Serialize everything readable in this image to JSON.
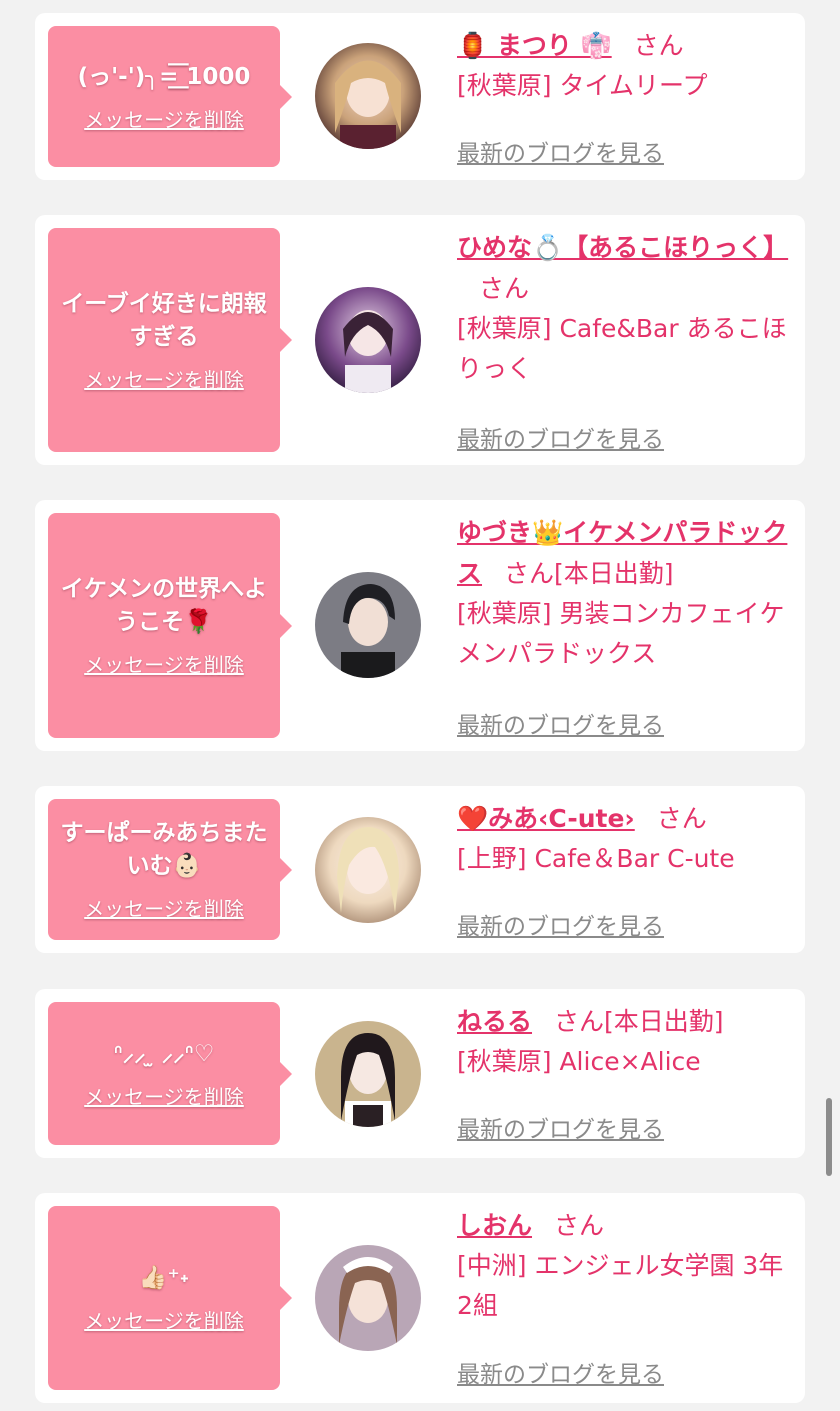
{
  "delete_label": "メッセージを削除",
  "blog_label": "最新のブログを見る",
  "san_label": "さん",
  "colors": {
    "background": "#f2f2f2",
    "card": "#ffffff",
    "bubble": "#fb8ea3",
    "accent": "#e4336a",
    "muted": "#8a8a8a"
  },
  "messages": [
    {
      "message": "(っ'-')╮=͟͟͞͞ 1000",
      "name": "🏮 まつり 👘",
      "badge": "",
      "shop": "[秋葉原] タイムリープ",
      "avatar_icon": "avatar-photo"
    },
    {
      "message": "イーブイ好きに朗報すぎる",
      "name": "ひめな💍【あるこほりっく】",
      "badge": "",
      "shop": "[秋葉原] Cafe&Bar あるこほりっく",
      "avatar_icon": "avatar-photo"
    },
    {
      "message": "イケメンの世界へようこそ🌹",
      "name": "ゆづき👑イケメンパラドックス",
      "badge": "[本日出勤]",
      "shop": "[秋葉原] 男装コンカフェイケメンパラドックス",
      "avatar_icon": "avatar-photo"
    },
    {
      "message": "すーぱーみあちまたいむ👶🏻",
      "name": "❤️みあ‹C-ute›",
      "badge": "",
      "shop": "[上野] Cafe＆Bar C-ute",
      "avatar_icon": "avatar-photo"
    },
    {
      "message": "ᐢ⸝⸝ ̫ ⸝⸝ᐢ♡",
      "name": "ねるる",
      "badge": "[本日出勤]",
      "shop": "[秋葉原] Alice×Alice",
      "avatar_icon": "avatar-photo"
    },
    {
      "message": "👍🏻⁺˖",
      "name": "しおん",
      "badge": "",
      "shop": "[中洲] エンジェル女学園 3年2組",
      "avatar_icon": "avatar-photo"
    }
  ]
}
